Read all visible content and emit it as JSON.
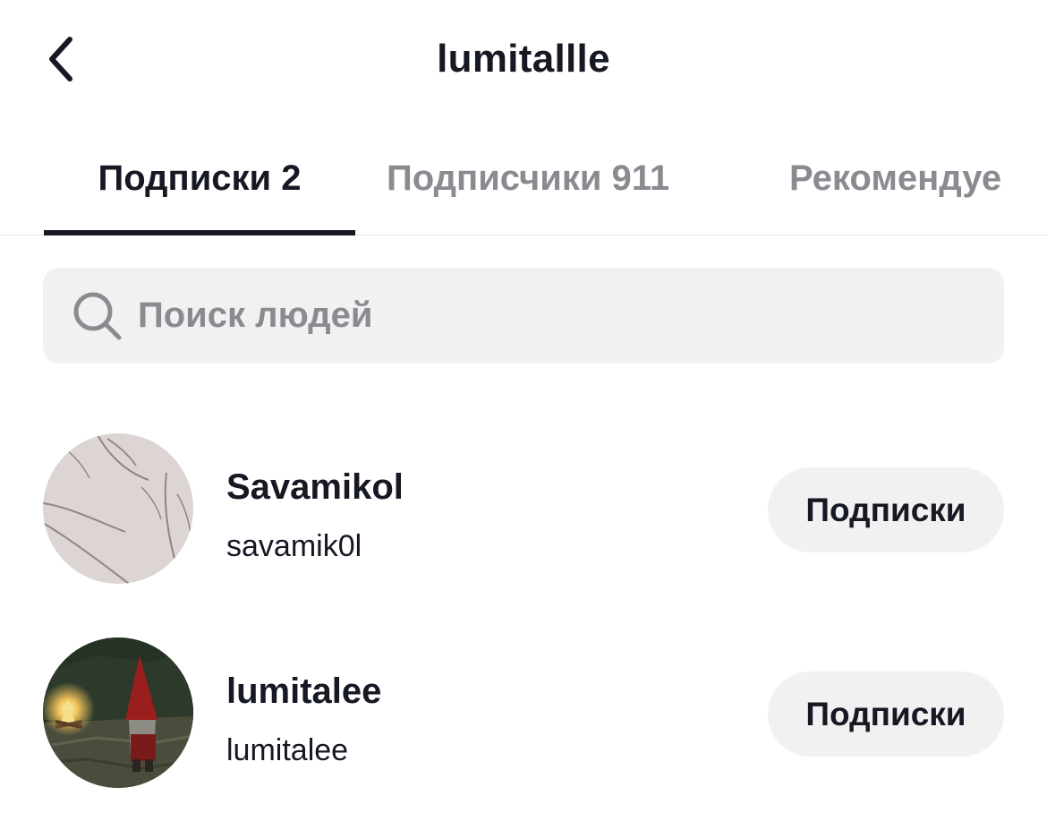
{
  "header": {
    "title": "lumitallle",
    "back_icon": "chevron-left-icon"
  },
  "tabs": [
    {
      "label": "Подписки 2",
      "active": true
    },
    {
      "label": "Подписчики 911",
      "active": false
    },
    {
      "label": "Рекомендуе",
      "active": false
    }
  ],
  "search": {
    "placeholder": "Поиск людей",
    "value": "",
    "icon": "search-icon"
  },
  "users": [
    {
      "display_name": "Savamikol",
      "username": "savamik0l",
      "button_label": "Подписки",
      "avatar": "sketch-avatar"
    },
    {
      "display_name": "lumitalee",
      "username": "lumitalee",
      "button_label": "Подписки",
      "avatar": "gnome-campfire-avatar"
    }
  ],
  "colors": {
    "text_primary": "#161823",
    "text_secondary": "#8a8b91",
    "surface": "#f1f1f2",
    "divider": "#e6e6e8"
  }
}
